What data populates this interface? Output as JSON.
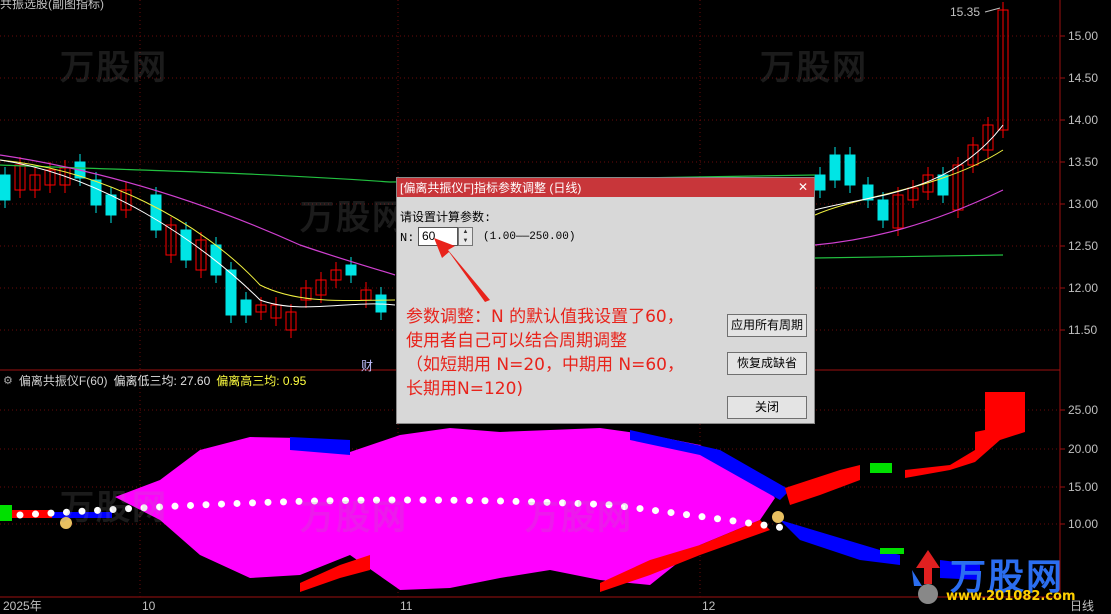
{
  "window": {
    "top_title_fragment": "共振选股(副图指标)"
  },
  "price_axis": {
    "labels": [
      "15.00",
      "14.50",
      "14.00",
      "13.50",
      "13.00",
      "12.50",
      "12.00",
      "11.50"
    ],
    "high_marker": "15.35"
  },
  "indicator_axis": {
    "labels": [
      "25.00",
      "20.00",
      "15.00",
      "10.00"
    ]
  },
  "time_axis": {
    "labels": [
      "2025年",
      "10",
      "11",
      "12"
    ],
    "period": "日线"
  },
  "chart_marks": {
    "cai_label": "财"
  },
  "sub_indicator": {
    "name": "偏离共振仪F(60)",
    "low_label": "偏离低三均: 27.60",
    "high_label": "偏离高三均: 0.95"
  },
  "dialog": {
    "title": "[偏离共振仪F]指标参数调整 (日线)",
    "close_glyph": "✕",
    "prompt": "请设置计算参数:",
    "param_label": "N:",
    "param_value": "60",
    "param_range": "(1.00——250.00)",
    "buttons": {
      "apply_all": "应用所有周期",
      "restore_default": "恢复成缺省",
      "close": "关闭"
    }
  },
  "annotation": {
    "line1": "参数调整：N 的默认值我设置了60，",
    "line2": "使用者自己可以结合周期调整",
    "line3": "（如短期用 N=20，中期用 N=60，",
    "line4": "长期用N=120)"
  },
  "watermark": {
    "brand": "万股网",
    "url": "www.201082.com"
  },
  "colors": {
    "bg": "#000000",
    "magenta": "#ff00ff",
    "red": "#ff0000",
    "blue": "#0000ff",
    "green": "#00e000",
    "cyan": "#00e5e5",
    "dialog_title": "#c8363a",
    "annotation": "#e8231b"
  }
}
